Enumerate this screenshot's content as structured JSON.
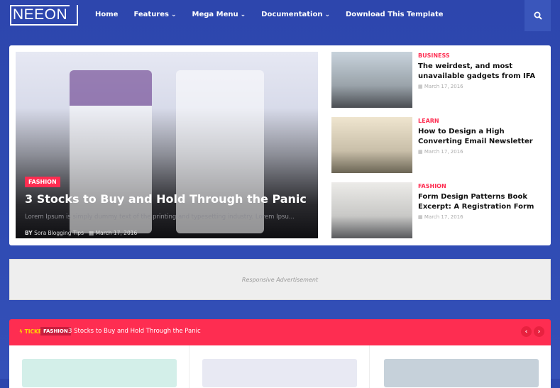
{
  "header": {
    "logo": "NEEON",
    "menu": [
      {
        "label": "Home",
        "dropdown": false
      },
      {
        "label": "Features",
        "dropdown": true
      },
      {
        "label": "Mega Menu",
        "dropdown": true
      },
      {
        "label": "Documentation",
        "dropdown": true
      },
      {
        "label": "Download This Template",
        "dropdown": false
      }
    ],
    "search_icon": "search-icon"
  },
  "featured": {
    "category": "FASHION",
    "title": "3 Stocks to Buy and Hold Through the Panic",
    "excerpt": "Lorem Ipsum is simply dummy text of the printing and typesetting industry. Lorem Ipsu...",
    "by": "BY",
    "author": "Sora Blogging Tips",
    "date": "March 17, 2016"
  },
  "side_posts": [
    {
      "category": "BUSINESS",
      "title": "The weirdest, and most unavailable gadgets from IFA",
      "date": "March 17, 2016"
    },
    {
      "category": "LEARN",
      "title": "How to Design a High Converting Email Newsletter",
      "date": "March 17, 2016"
    },
    {
      "category": "FASHION",
      "title": "Form Design Patterns Book Excerpt: A Registration Form",
      "date": "March 17, 2016"
    }
  ],
  "ad": {
    "text": "Responsive Advertisement"
  },
  "ticker": {
    "label": "TICKER",
    "category": "FASHION",
    "text": "3 Stocks to Buy and Hold Through the Panic"
  },
  "colors": {
    "accent": "#fe2d51",
    "background": "#2f4bb0"
  }
}
